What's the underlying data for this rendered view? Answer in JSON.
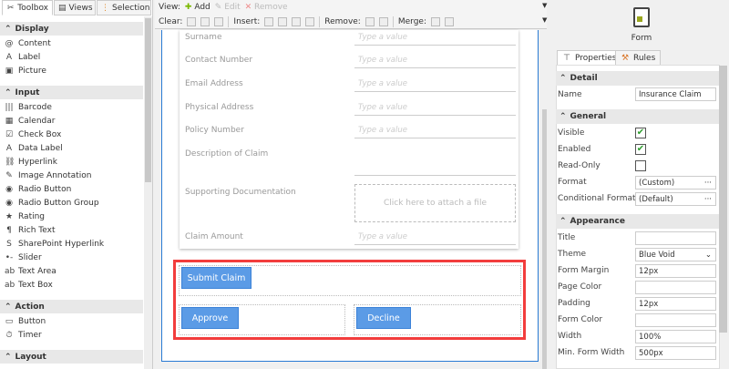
{
  "left_panel": {
    "tabs": [
      {
        "label": "Toolbox",
        "icon": "tools-icon"
      },
      {
        "label": "Views",
        "icon": "views-icon"
      },
      {
        "label": "Selection",
        "icon": "selection-icon"
      }
    ],
    "sections": [
      {
        "label": "Display",
        "items": [
          "Content",
          "Label",
          "Picture"
        ]
      },
      {
        "label": "Input",
        "items": [
          "Barcode",
          "Calendar",
          "Check Box",
          "Data Label",
          "Hyperlink",
          "Image Annotation",
          "Radio Button",
          "Radio Button Group",
          "Rating",
          "Rich Text",
          "SharePoint Hyperlink",
          "Slider",
          "Text Area",
          "Text Box"
        ]
      },
      {
        "label": "Action",
        "items": [
          "Button",
          "Timer"
        ]
      },
      {
        "label": "Layout",
        "items": []
      }
    ]
  },
  "toolbar": {
    "view_label": "View:",
    "add": "Add",
    "edit": "Edit",
    "remove": "Remove",
    "clear_label": "Clear:",
    "insert_label": "Insert:",
    "remove_label": "Remove:",
    "merge_label": "Merge:"
  },
  "form": {
    "placeholder": "Type a value",
    "fields": [
      "Surname",
      "Contact Number",
      "Email Address",
      "Physical Address",
      "Policy Number",
      "Description of Claim",
      "Supporting Documentation",
      "Claim Amount"
    ],
    "attach_text": "Click here to attach a file",
    "buttons": {
      "submit": "Submit Claim",
      "approve": "Approve",
      "decline": "Decline"
    }
  },
  "right_panel": {
    "object_label": "Form",
    "tabs": [
      "Properties",
      "Rules"
    ],
    "detail": {
      "header": "Detail",
      "name_label": "Name",
      "name_value": "Insurance Claim"
    },
    "general": {
      "header": "General",
      "visible": "Visible",
      "enabled": "Enabled",
      "read_only": "Read-Only",
      "format": "Format",
      "format_value": "(Custom)",
      "cond_format": "Conditional Format",
      "cond_format_value": "(Default)",
      "more": "···",
      "visible_checked": true,
      "enabled_checked": true,
      "read_only_checked": false
    },
    "appearance": {
      "header": "Appearance",
      "rows": [
        {
          "label": "Title",
          "value": ""
        },
        {
          "label": "Theme",
          "value": "Blue Void"
        },
        {
          "label": "Form Margin",
          "value": "12px"
        },
        {
          "label": "Page Color",
          "value": ""
        },
        {
          "label": "Padding",
          "value": "12px"
        },
        {
          "label": "Form Color",
          "value": ""
        },
        {
          "label": "Width",
          "value": "100%"
        },
        {
          "label": "Min. Form Width",
          "value": "500px"
        }
      ]
    }
  },
  "colors": {
    "accent": "#5b9be6",
    "highlight": "#f23d3d",
    "frame": "#2a7bd4"
  }
}
